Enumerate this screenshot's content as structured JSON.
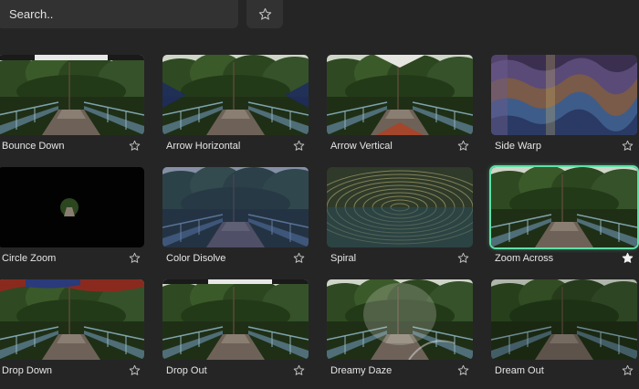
{
  "search": {
    "placeholder": "Search.."
  },
  "toolbar": {
    "favorites_icon": "star-outline-icon"
  },
  "colors": {
    "background": "#252525",
    "control": "#323232",
    "selected_accent": "#5ee0a6"
  },
  "transitions": [
    {
      "label": "Bounce Down",
      "favorite": false,
      "selected": false
    },
    {
      "label": "Arrow Horizontal",
      "favorite": false,
      "selected": false
    },
    {
      "label": "Arrow Vertical",
      "favorite": false,
      "selected": false
    },
    {
      "label": "Side Warp",
      "favorite": false,
      "selected": false
    },
    {
      "label": "Circle Zoom",
      "favorite": false,
      "selected": false
    },
    {
      "label": "Color Disolve",
      "favorite": false,
      "selected": false
    },
    {
      "label": "Spiral",
      "favorite": false,
      "selected": false
    },
    {
      "label": "Zoom Across",
      "favorite": true,
      "selected": true
    },
    {
      "label": "Drop Down",
      "favorite": false,
      "selected": false
    },
    {
      "label": "Drop Out",
      "favorite": false,
      "selected": false
    },
    {
      "label": "Dreamy Daze",
      "favorite": false,
      "selected": false
    },
    {
      "label": "Dream Out",
      "favorite": false,
      "selected": false
    }
  ]
}
